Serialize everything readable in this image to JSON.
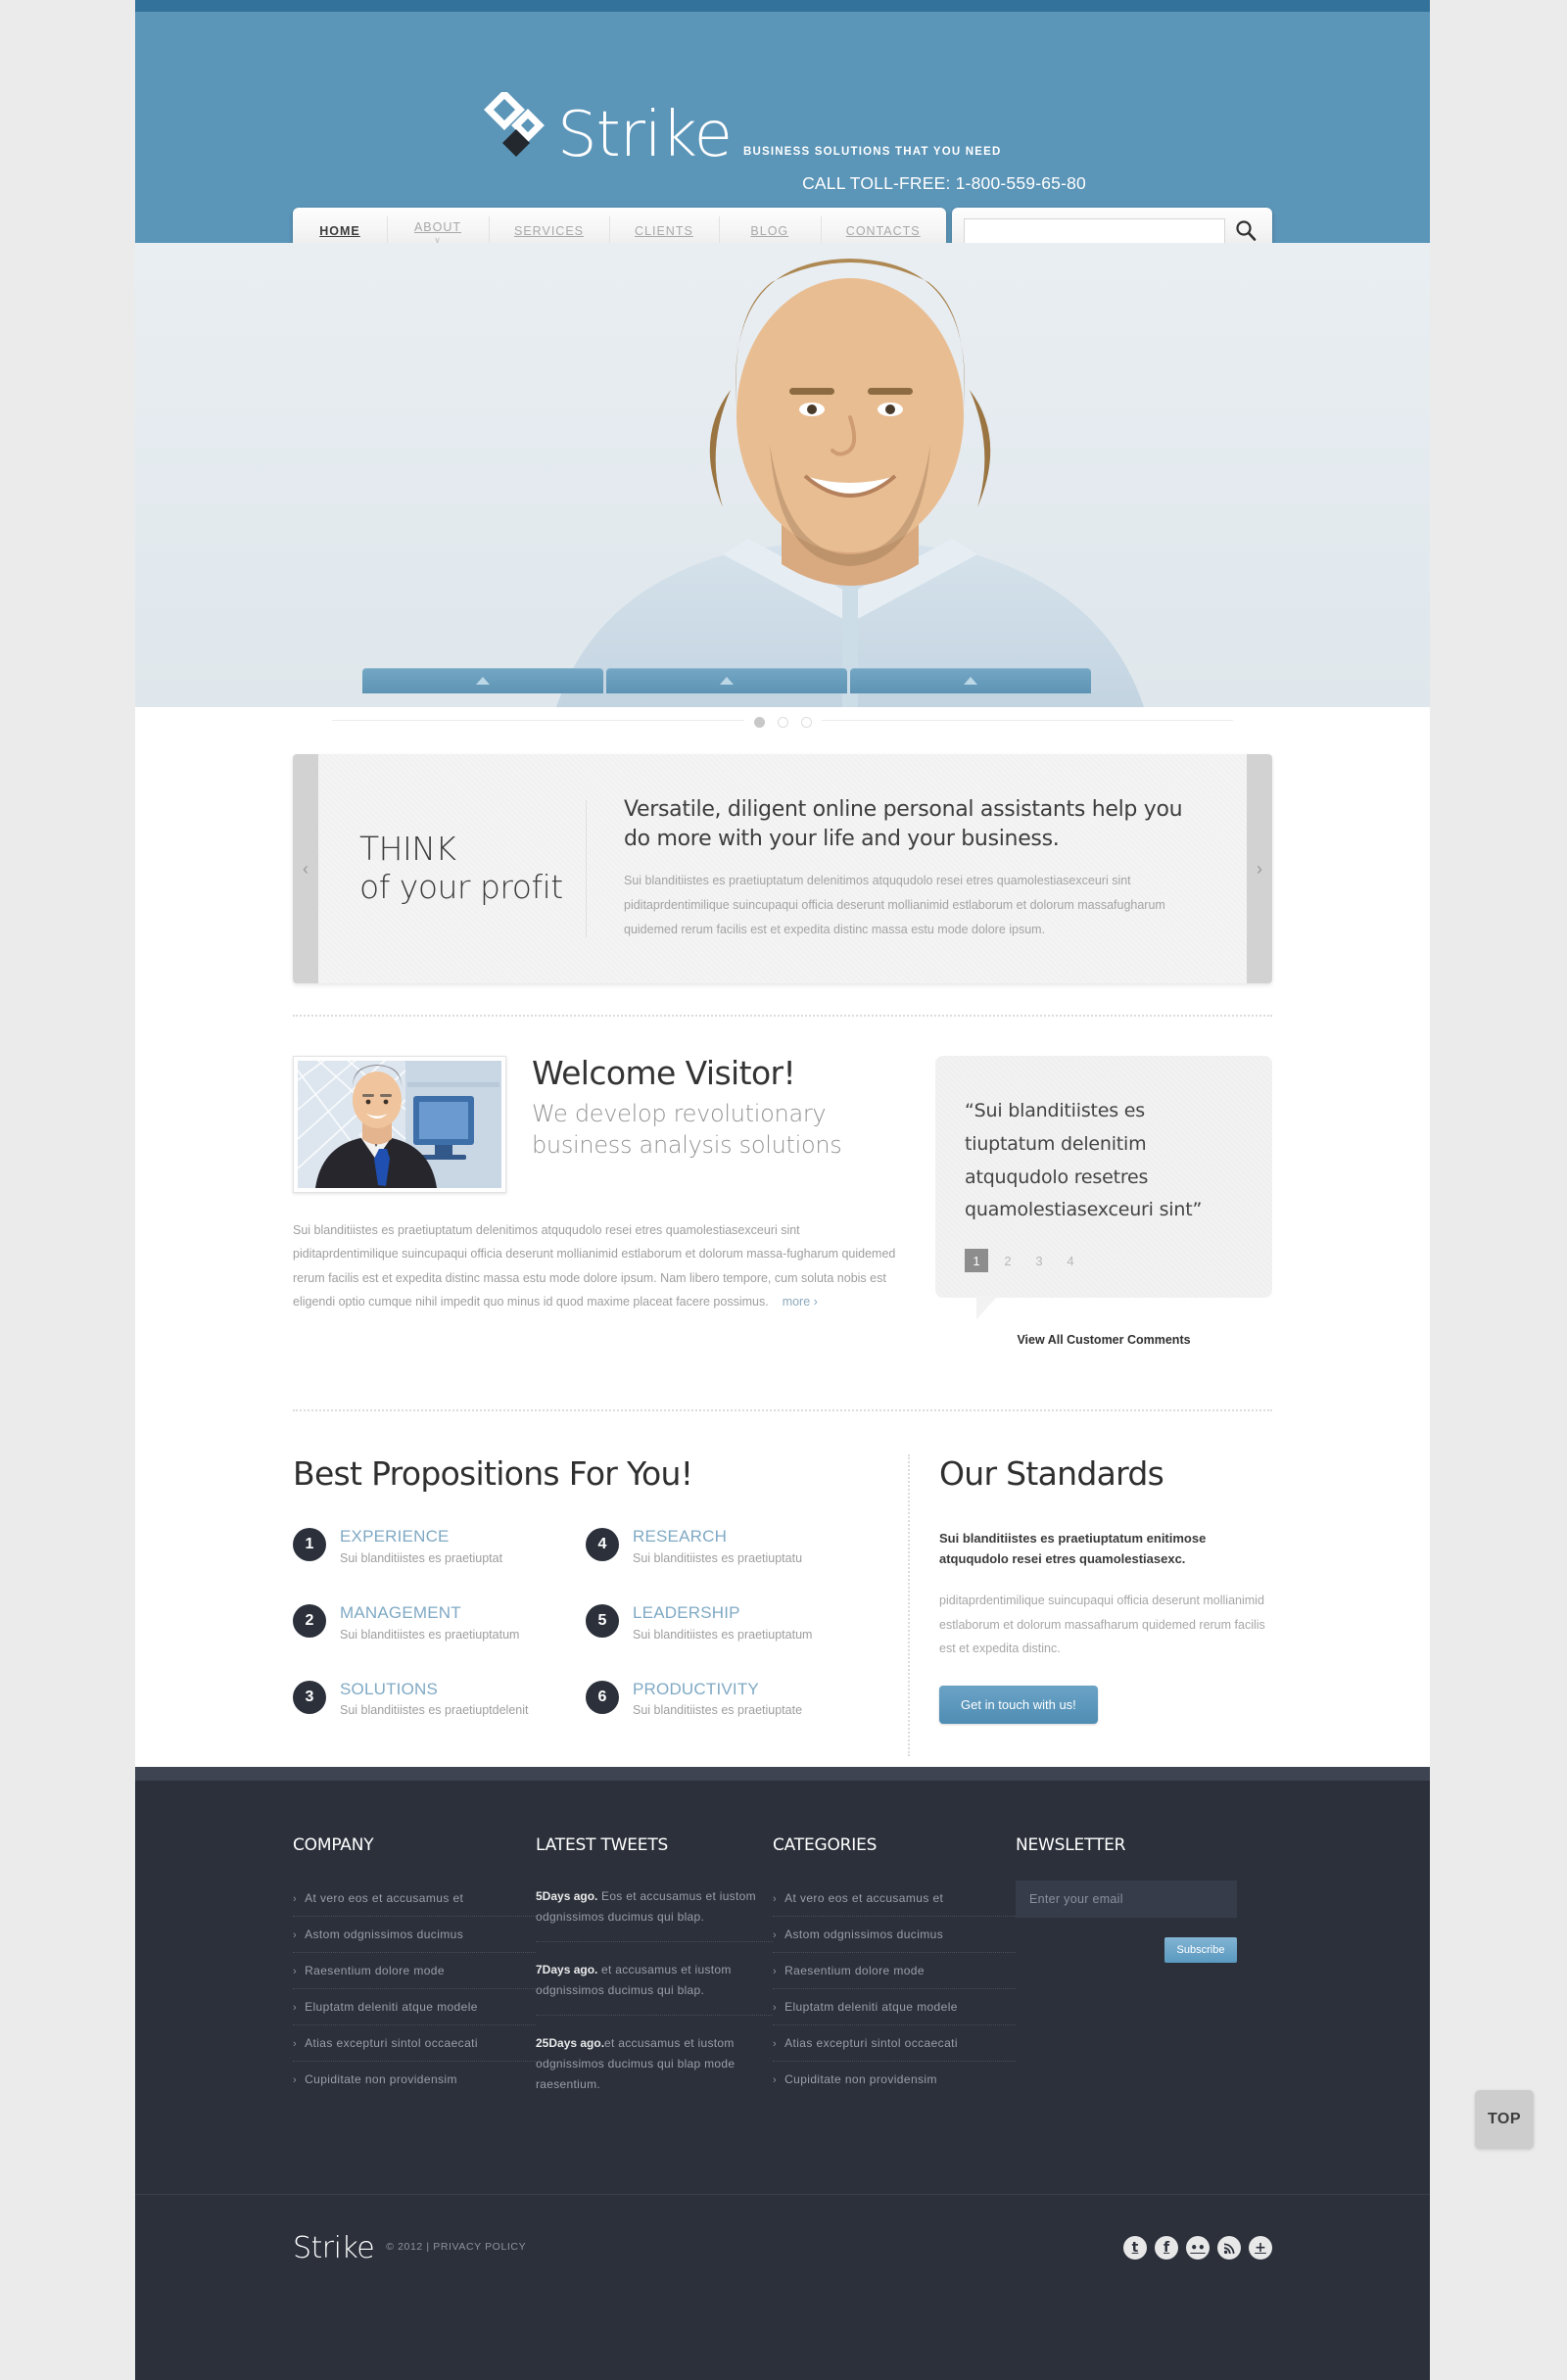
{
  "brand": {
    "name": "Strike",
    "tagline": "BUSINESS SOLUTIONS THAT YOU NEED",
    "phone": "CALL TOLL-FREE: 1-800-559-65-80",
    "accent": "#5b95b8",
    "dark": "#2b303b"
  },
  "nav": {
    "items": [
      {
        "label": "HOME",
        "active": true
      },
      {
        "label": "ABOUT",
        "caret": "∨"
      },
      {
        "label": "SERVICES"
      },
      {
        "label": "CLIENTS"
      },
      {
        "label": "BLOG"
      },
      {
        "label": "CONTACTS"
      }
    ],
    "search_value": "",
    "search_placeholder": ""
  },
  "hero": {
    "tabs": [
      "",
      "",
      ""
    ],
    "dots": [
      true,
      false,
      false
    ]
  },
  "promo": {
    "kicker": "THINK",
    "sub": "of your profit",
    "title": "Versatile, diligent online personal assistants help you do more with your life and your business.",
    "text": "Sui blanditiistes es praetiuptatum delenitimos atququdolo resei etres quamolestiasexceuri sint piditaprdentimilique suincupaqui officia deserunt mollianimid estlaborum et dolorum massafugharum quidemed rerum facilis est et expedita distinc massa estu mode dolore ipsum.",
    "prev": "‹",
    "next": "›"
  },
  "welcome": {
    "title": "Welcome Visitor!",
    "subtitle": "We develop revolutionary business analysis solutions",
    "body": "Sui blanditiistes es praetiuptatum delenitimos atququdolo resei etres quamolestiasexceuri sint piditaprdentimilique suincupaqui officia deserunt mollianimid estlaborum et dolorum massa-fugharum quidemed rerum facilis est et expedita distinc massa estu mode dolore ipsum. Nam libero tempore, cum soluta nobis est eligendi optio cumque nihil impedit quo minus id quod maxime placeat facere possimus.",
    "more": "more ›"
  },
  "testimonial": {
    "quote": "“Sui blanditiistes es tiuptatum delenitim atququdolo resetres quamolestiasexceuri sint”",
    "pager": [
      "1",
      "2",
      "3",
      "4"
    ],
    "active_page": 0,
    "view_all": "View All Customer Comments"
  },
  "propositions": {
    "heading": "Best Propositions For You!",
    "items": [
      {
        "num": "1",
        "title": "EXPERIENCE",
        "desc": "Sui blanditiistes es praetiuptat"
      },
      {
        "num": "4",
        "title": "RESEARCH",
        "desc": "Sui blanditiistes es praetiuptatu"
      },
      {
        "num": "2",
        "title": "MANAGEMENT",
        "desc": "Sui blanditiistes es praetiuptatum"
      },
      {
        "num": "5",
        "title": "LEADERSHIP",
        "desc": "Sui blanditiistes es praetiuptatum"
      },
      {
        "num": "3",
        "title": "SOLUTIONS",
        "desc": "Sui blanditiistes es praetiuptdelenit"
      },
      {
        "num": "6",
        "title": "PRODUCTIVITY",
        "desc": "Sui blanditiistes es praetiuptate"
      }
    ]
  },
  "standards": {
    "heading": "Our Standards",
    "lead": "Sui blanditiistes es praetiuptatum enitimose atququdolo resei etres quamolestiasexc.",
    "text": "piditaprdentimilique suincupaqui officia deserunt mollianimid estlaborum et dolorum massafharum quidemed rerum facilis est et expedita distinc.",
    "button": "Get in touch with us!"
  },
  "footer": {
    "company": {
      "heading": "COMPANY",
      "items": [
        "At vero eos et accusamus et",
        "Astom odgnissimos ducimus",
        "Raesentium dolore mode",
        "Eluptatm deleniti atque modele",
        "Atias excepturi sintol occaecati",
        "Cupiditate non providensim"
      ]
    },
    "tweets": {
      "heading": "LATEST TWEETS",
      "items": [
        {
          "when": "5Days ago.",
          "text": " Eos et accusamus et iustom odgnissimos ducimus qui blap."
        },
        {
          "when": "7Days ago.",
          "text": " et accusamus et iustom odgnissimos ducimus qui blap."
        },
        {
          "when": "25Days ago.",
          "text": "et accusamus et iustom odgnissimos ducimus qui blap mode raesentium."
        }
      ]
    },
    "categories": {
      "heading": "CATEGORIES",
      "items": [
        "At vero eos et accusamus et",
        "Astom odgnissimos ducimus",
        "Raesentium dolore mode",
        "Eluptatm deleniti atque modele",
        "Atias excepturi sintol occaecati",
        "Cupiditate non providensim"
      ]
    },
    "newsletter": {
      "heading": "NEWSLETTER",
      "placeholder": "Enter your email",
      "value": "",
      "button": "Subscribe"
    }
  },
  "bottom": {
    "logo": "Strike",
    "copyright": "© 2012 | PRIVACY POLICY",
    "socials": [
      "twitter-icon",
      "facebook-icon",
      "flickr-icon",
      "rss-icon",
      "googleplus-icon"
    ]
  },
  "top_button": {
    "label": "TOP"
  }
}
